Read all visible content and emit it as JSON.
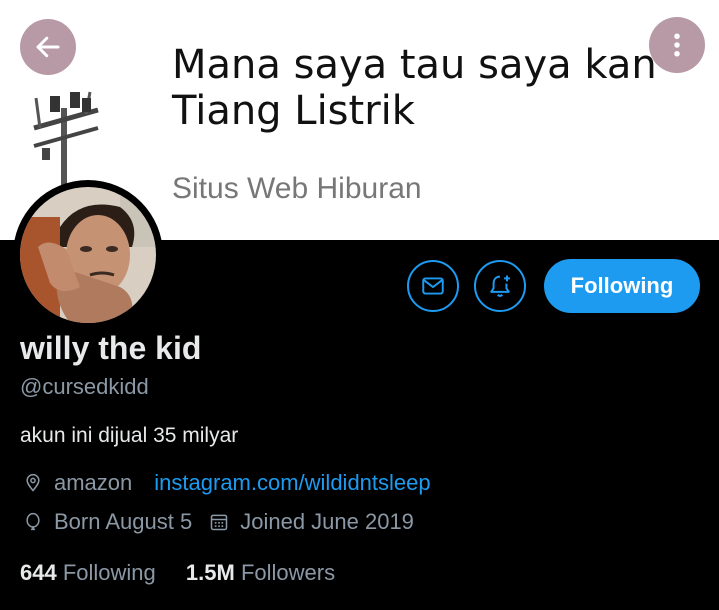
{
  "banner": {
    "title": "Mana saya tau saya kan\nTiang Listrik",
    "subtitle": "Situs Web Hiburan"
  },
  "nav": {
    "back_icon": "back-arrow-icon",
    "more_icon": "more-vertical-icon"
  },
  "actions": {
    "message_icon": "mail-icon",
    "notify_icon": "bell-plus-icon",
    "follow_label": "Following"
  },
  "profile": {
    "name": "willy the kid",
    "handle": "@cursedkidd",
    "bio": "akun ini dijual 35 milyar",
    "location": "amazon",
    "website": "instagram.com/wildidntsleep",
    "birthday": "Born August 5",
    "joined": "Joined June 2019"
  },
  "stats": {
    "following_count": "644",
    "following_label": "Following",
    "followers_count": "1.5M",
    "followers_label": "Followers"
  },
  "colors": {
    "accent": "#1d9bf0",
    "background": "#000000",
    "text": "#e7e9ea",
    "muted": "#8b98a5"
  }
}
